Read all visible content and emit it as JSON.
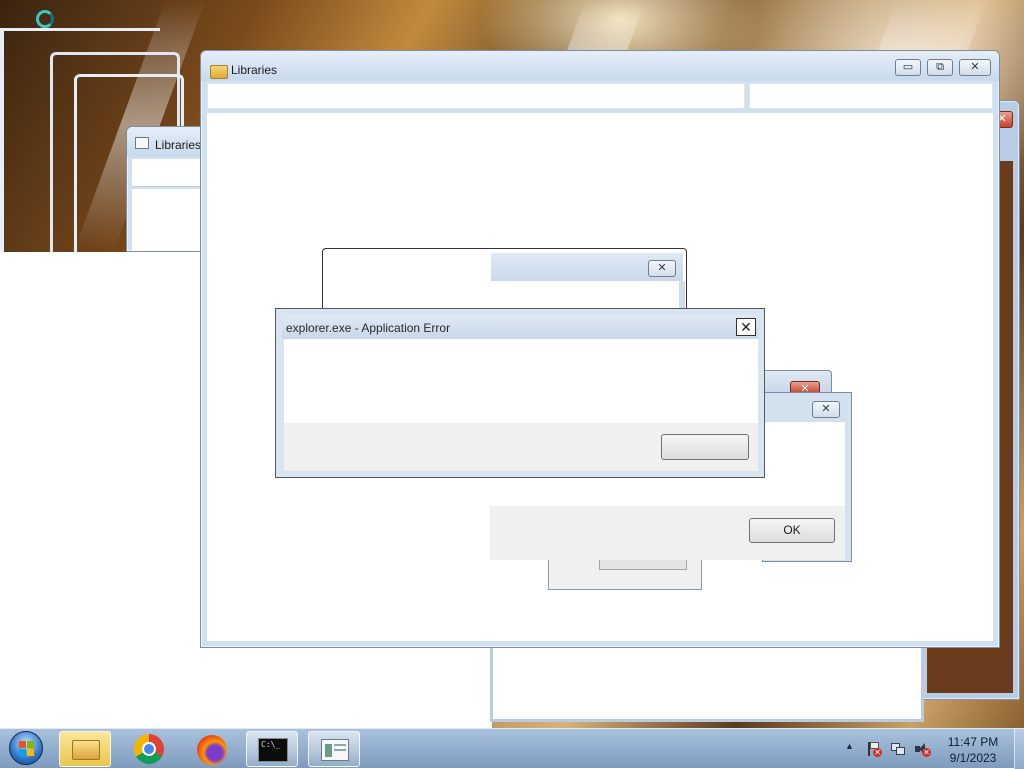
{
  "desktop": {
    "busy_cursor_icon": "loading-ring-icon"
  },
  "windows": {
    "back_libraries": {
      "title": "Libraries"
    },
    "main_libraries": {
      "title": "Libraries",
      "minimize_glyph": "▭",
      "restore_glyph": "⧉",
      "close_glyph": "✕"
    },
    "dialog_back": {
      "close_glyph": "✕"
    },
    "dialog_mid": {
      "close_glyph": "✕",
      "ok_label": "OK"
    },
    "dialog_front": {
      "title": "explorer.exe - Application Error",
      "close_glyph": "✕",
      "button_label": ""
    }
  },
  "taskbar": {
    "start_icon": "windows-start-orb-icon",
    "pinned": [
      {
        "name": "file-explorer-icon",
        "active": true
      },
      {
        "name": "chrome-icon",
        "active": false
      },
      {
        "name": "firefox-icon",
        "active": false
      },
      {
        "name": "command-prompt-icon",
        "active": true
      },
      {
        "name": "libraries-window-icon",
        "active": true
      }
    ],
    "cmd_label": "C:\\_",
    "tray": {
      "show_hidden_glyph": "▲",
      "icons": [
        "action-center-flag-icon",
        "network-icon",
        "volume-muted-icon"
      ]
    },
    "clock": {
      "time": "11:47 PM",
      "date": "9/1/2023"
    }
  },
  "colors": {
    "accent": "#7e9cbe",
    "close_red": "#c4402a",
    "dialog_bg": "#f0f0f0"
  }
}
